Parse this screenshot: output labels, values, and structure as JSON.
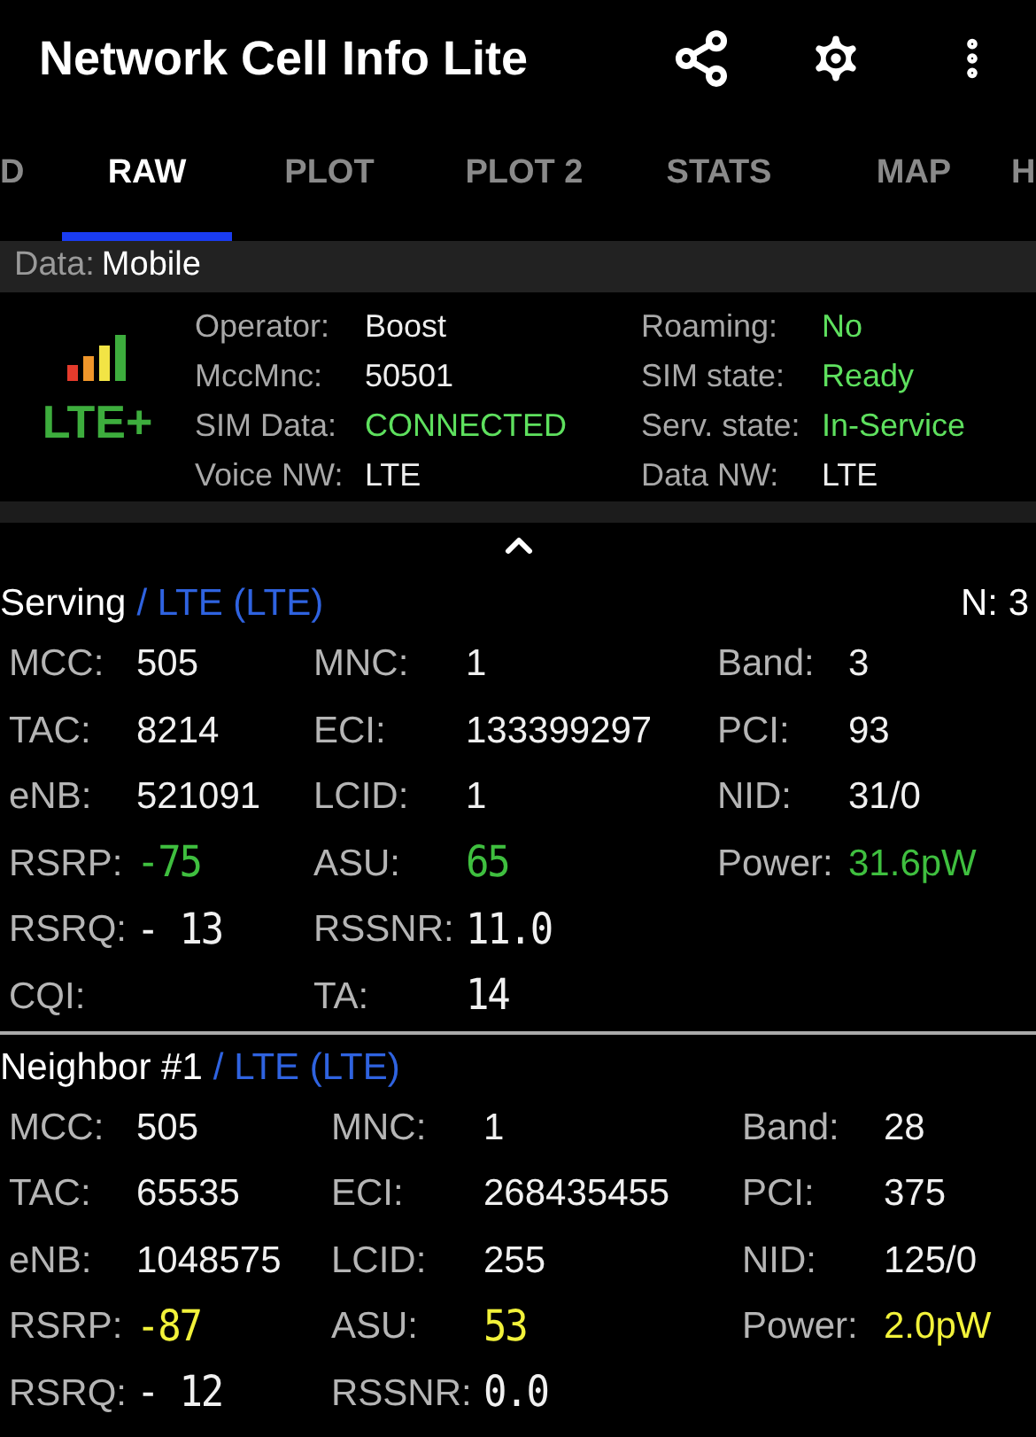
{
  "app_bar": {
    "title": "Network Cell Info Lite"
  },
  "tabs": [
    {
      "label": "D",
      "selected": false
    },
    {
      "label": "RAW",
      "selected": true
    },
    {
      "label": "PLOT",
      "selected": false
    },
    {
      "label": "PLOT 2",
      "selected": false
    },
    {
      "label": "STATS",
      "selected": false
    },
    {
      "label": "MAP",
      "selected": false
    },
    {
      "label": "H",
      "selected": false
    }
  ],
  "data_bar": {
    "label": "Data:",
    "value": "Mobile"
  },
  "summary": {
    "network_badge": "LTE+",
    "info": [
      {
        "label": "Operator:",
        "value": "Boost"
      },
      {
        "label": "Roaming:",
        "value": "No",
        "color": "#5ee05e"
      },
      {
        "label": "MccMnc:",
        "value": "50501"
      },
      {
        "label": "SIM state:",
        "value": "Ready",
        "color": "#5ee05e"
      },
      {
        "label": "SIM Data:",
        "value": "CONNECTED",
        "color": "#5ee05e"
      },
      {
        "label": "Serv. state:",
        "value": "In-Service",
        "color": "#5ee05e"
      },
      {
        "label": "Voice NW:",
        "value": "LTE"
      },
      {
        "label": "Data NW:",
        "value": "LTE"
      }
    ]
  },
  "sections": [
    {
      "title": "Serving",
      "tech": "/ LTE (LTE)",
      "count": "N: 3",
      "rows": [
        [
          {
            "label": "MCC:",
            "value": "505",
            "kind": "text"
          },
          {
            "label": "MNC:",
            "value": "1",
            "kind": "text"
          },
          {
            "label": "Band:",
            "value": "3",
            "kind": "text"
          }
        ],
        [
          {
            "label": "TAC:",
            "value": "8214",
            "kind": "text"
          },
          {
            "label": "ECI:",
            "value": "133399297",
            "kind": "text"
          },
          {
            "label": "PCI:",
            "value": "93",
            "kind": "text"
          }
        ],
        [
          {
            "label": "eNB:",
            "value": "521091",
            "kind": "text"
          },
          {
            "label": "LCID:",
            "value": "1",
            "kind": "text"
          },
          {
            "label": "NID:",
            "value": "31/0",
            "kind": "text"
          }
        ],
        [
          {
            "label": "RSRP:",
            "value": "-75",
            "kind": "digital",
            "color": "#3fbf3f"
          },
          {
            "label": "ASU:",
            "value": "65",
            "kind": "digital",
            "color": "#3fbf3f"
          },
          {
            "label": "Power:",
            "value": "31.6pW",
            "kind": "text",
            "color": "#3fbf3f"
          }
        ],
        [
          {
            "label": "RSRQ:",
            "value": "- 13",
            "kind": "digital"
          },
          {
            "label": "RSSNR:",
            "value": "11.0",
            "kind": "digital"
          }
        ],
        [
          {
            "label": "CQI:",
            "kind": "text"
          },
          {
            "label": "TA:",
            "value": "14",
            "kind": "digital"
          }
        ]
      ]
    },
    {
      "title": "Neighbor #1",
      "tech": "/ LTE (LTE)",
      "rows": [
        [
          {
            "label": "MCC:",
            "value": "505",
            "kind": "text"
          },
          {
            "label": "MNC:",
            "value": "1",
            "kind": "text"
          },
          {
            "label": "Band:",
            "value": "28",
            "kind": "text"
          }
        ],
        [
          {
            "label": "TAC:",
            "value": "65535",
            "kind": "text"
          },
          {
            "label": "ECI:",
            "value": "268435455",
            "kind": "text"
          },
          {
            "label": "PCI:",
            "value": "375",
            "kind": "text"
          }
        ],
        [
          {
            "label": "eNB:",
            "value": "1048575",
            "kind": "text"
          },
          {
            "label": "LCID:",
            "value": "255",
            "kind": "text"
          },
          {
            "label": "NID:",
            "value": "125/0",
            "kind": "text"
          }
        ],
        [
          {
            "label": "RSRP:",
            "value": "-87",
            "kind": "digital",
            "color": "#f2f23a"
          },
          {
            "label": "ASU:",
            "value": "53",
            "kind": "digital",
            "color": "#f2f23a"
          },
          {
            "label": "Power:",
            "value": "2.0pW",
            "kind": "text",
            "color": "#f2f23a"
          }
        ],
        [
          {
            "label": "RSRQ:",
            "value": "- 12",
            "kind": "digital"
          },
          {
            "label": "RSSNR:",
            "value": "0.0",
            "kind": "digital"
          }
        ]
      ]
    }
  ]
}
